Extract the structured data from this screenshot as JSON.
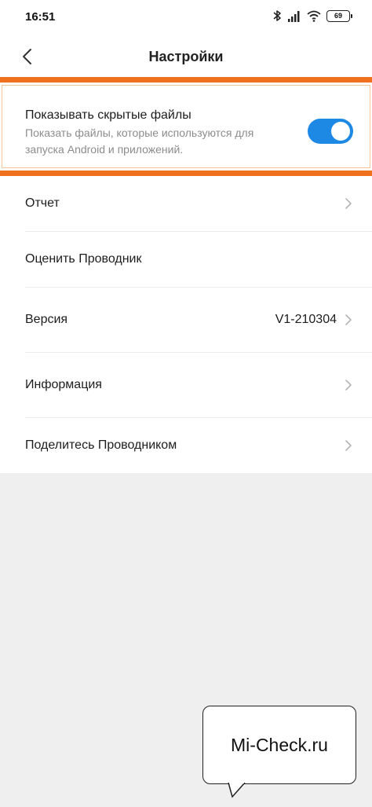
{
  "status_bar": {
    "time": "16:51",
    "battery": "69",
    "icons": [
      "bluetooth-icon",
      "signal-icon",
      "wifi-icon",
      "battery-icon"
    ]
  },
  "header": {
    "title": "Настройки",
    "back_icon": "chevron-left-icon"
  },
  "hidden_files": {
    "title": "Показывать скрытые файлы",
    "description": "Показать файлы, которые используются для запуска Android и приложений.",
    "toggle_on": true
  },
  "items": [
    {
      "label": "Отчет",
      "value": "",
      "chevron": true
    },
    {
      "label": "Оценить Проводник",
      "value": "",
      "chevron": false
    },
    {
      "label": "Версия",
      "value": "V1-210304",
      "chevron": true
    },
    {
      "label": "Информация",
      "value": "",
      "chevron": true
    },
    {
      "label": "Поделитесь Проводником",
      "value": "",
      "chevron": true
    }
  ],
  "watermark": "Mi-Check.ru",
  "colors": {
    "accent": "#1e88e5",
    "highlight": "#f0711d",
    "background": "#efefef"
  }
}
